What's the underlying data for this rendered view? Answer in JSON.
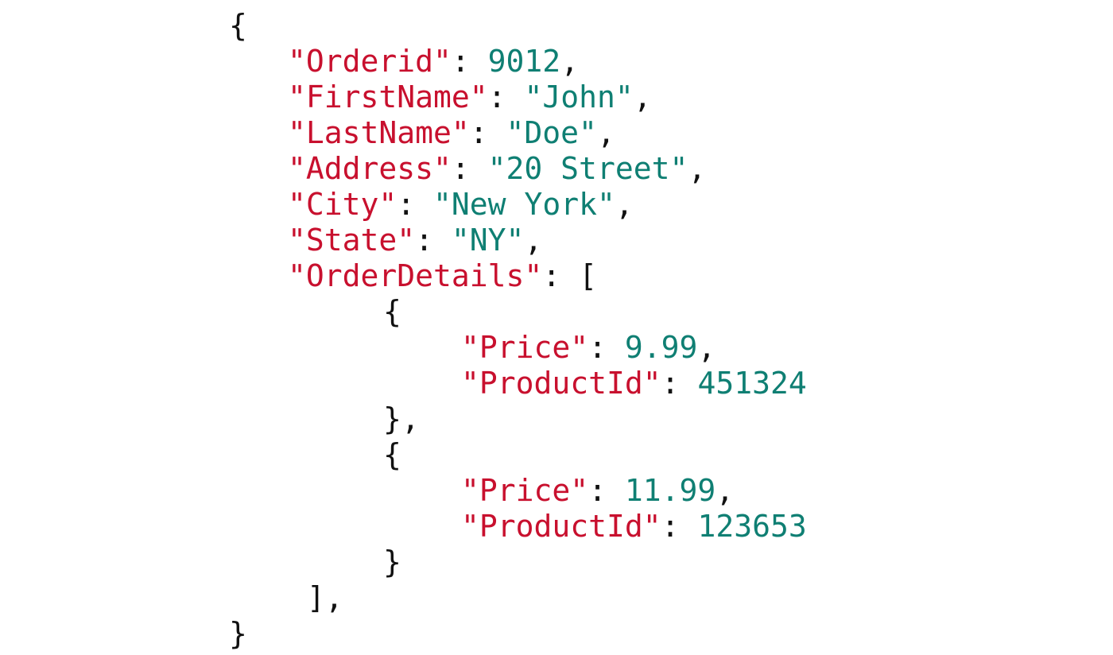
{
  "code": {
    "l1": {
      "open": "{"
    },
    "l2": {
      "key": "\"Orderid\"",
      "sep": ": ",
      "val": "9012",
      "tail": ","
    },
    "l3": {
      "key": "\"FirstName\"",
      "sep": ": ",
      "val": "\"John\"",
      "tail": ","
    },
    "l4": {
      "key": "\"LastName\"",
      "sep": ": ",
      "val": "\"Doe\"",
      "tail": ","
    },
    "l5": {
      "key": "\"Address\"",
      "sep": ": ",
      "val": "\"20 Street\"",
      "tail": ","
    },
    "l6": {
      "key": "\"City\"",
      "sep": ": ",
      "val": "\"New York\"",
      "tail": ","
    },
    "l7": {
      "key": "\"State\"",
      "sep": ": ",
      "val": "\"NY\"",
      "tail": ","
    },
    "l8": {
      "key": "\"OrderDetails\"",
      "sep": ": ",
      "open": "["
    },
    "l9": {
      "open": "{"
    },
    "l10": {
      "key": "\"Price\"",
      "sep": ": ",
      "val": "9.99",
      "tail": ","
    },
    "l11": {
      "key": "\"ProductId\"",
      "sep": ": ",
      "val": "451324"
    },
    "l12": {
      "close": "},"
    },
    "l13": {
      "open": "{"
    },
    "l14": {
      "key": "\"Price\"",
      "sep": ": ",
      "val": "11.99",
      "tail": ","
    },
    "l15": {
      "key": "\"ProductId\"",
      "sep": ": ",
      "val": "123653"
    },
    "l16": {
      "close": "}"
    },
    "l17": {
      "close": "],"
    },
    "l18": {
      "close": "}"
    }
  },
  "colors": {
    "key": "#c8102e",
    "value": "#0f7f73",
    "punctuation": "#111111",
    "background": "#ffffff"
  }
}
